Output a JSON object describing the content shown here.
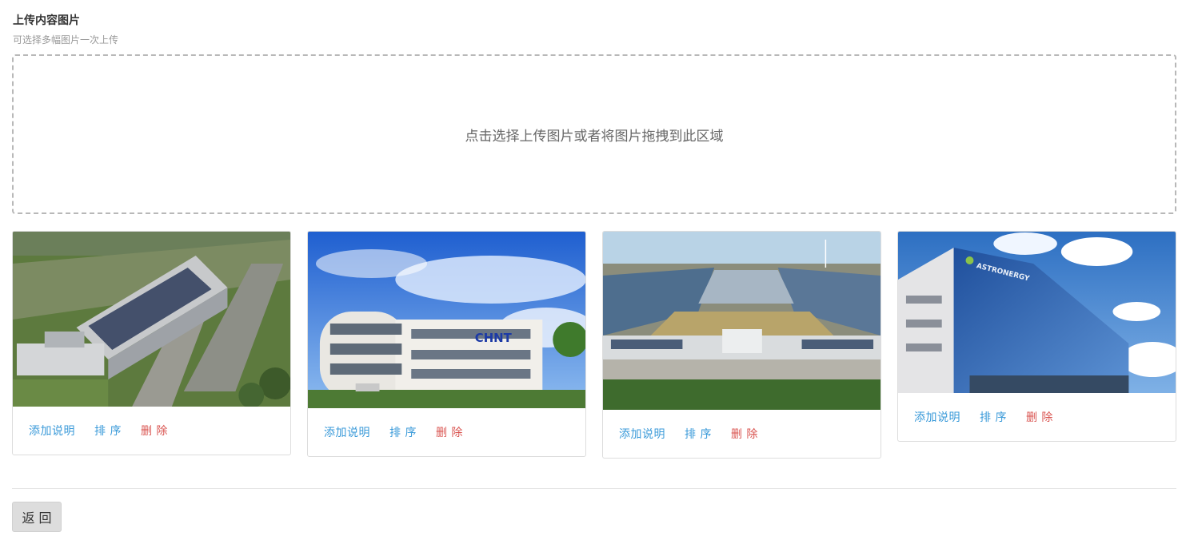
{
  "header": {
    "title": "上传内容图片",
    "subtitle": "可选择多幅图片一次上传"
  },
  "dropzone": {
    "text": "点击选择上传图片或者将图片拖拽到此区域"
  },
  "images": [
    {
      "caption_label": "添加说明",
      "sort_label": "排 序",
      "delete_label": "删 除"
    },
    {
      "caption_label": "添加说明",
      "sort_label": "排 序",
      "delete_label": "删 除",
      "logo_text": "CHNT"
    },
    {
      "caption_label": "添加说明",
      "sort_label": "排 序",
      "delete_label": "删 除"
    },
    {
      "caption_label": "添加说明",
      "sort_label": "排 序",
      "delete_label": "删 除",
      "logo_text": "ASTRONERGY"
    }
  ],
  "footer": {
    "back_label": "返 回"
  },
  "colors": {
    "link": "#3a9ad9",
    "danger": "#d9534f",
    "border": "#ddd"
  }
}
